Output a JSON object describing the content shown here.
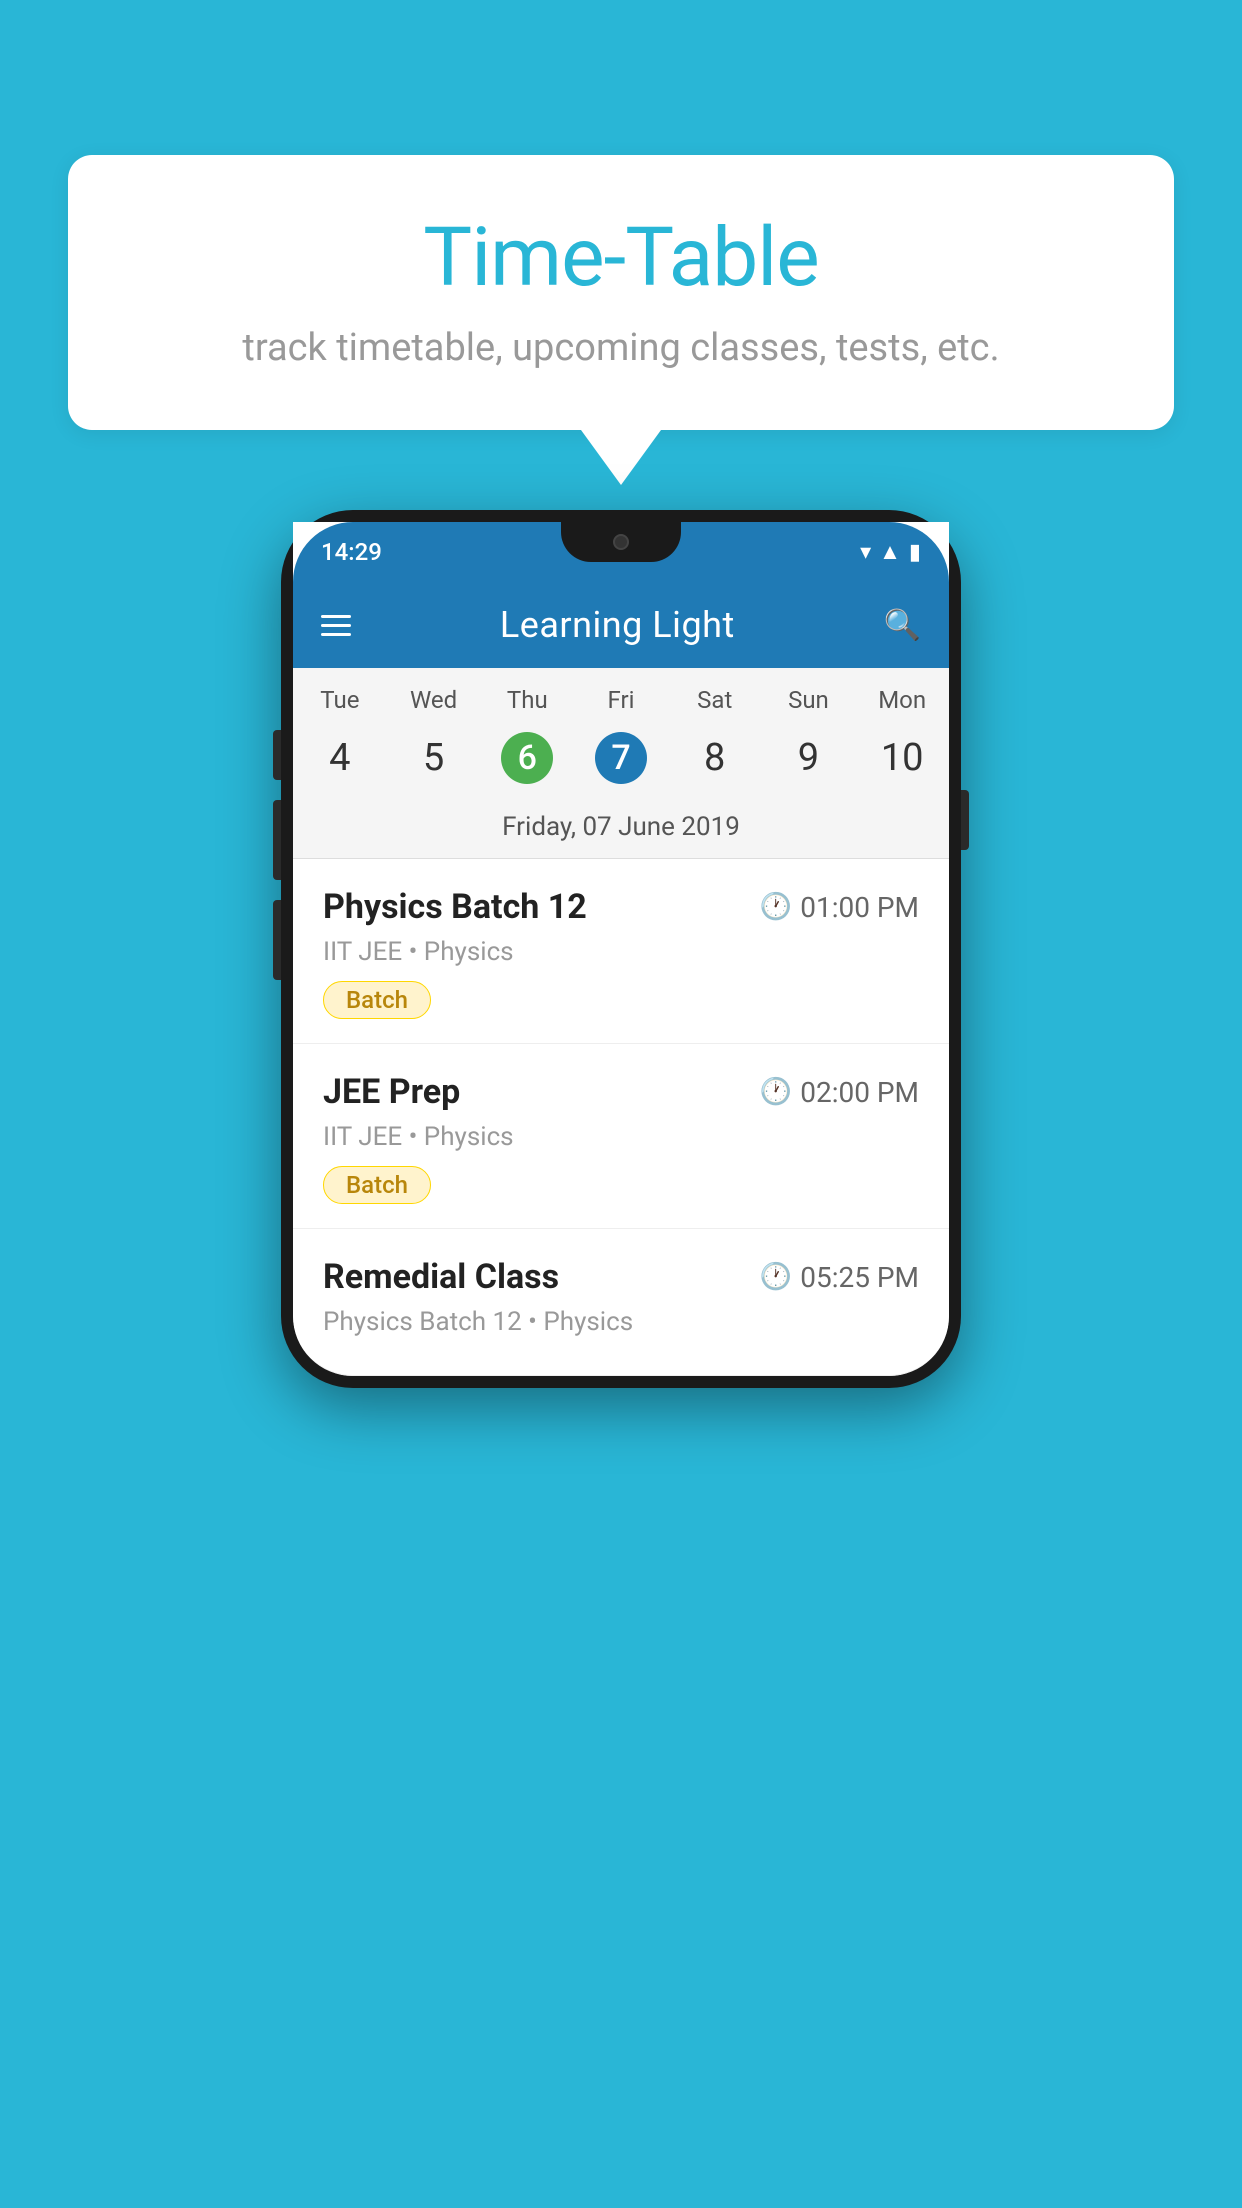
{
  "background_color": "#29B6D6",
  "bubble": {
    "title": "Time-Table",
    "subtitle": "track timetable, upcoming classes, tests, etc."
  },
  "phone": {
    "status_bar": {
      "time": "14:29"
    },
    "app_bar": {
      "title": "Learning Light"
    },
    "calendar": {
      "days": [
        "Tue",
        "Wed",
        "Thu",
        "Fri",
        "Sat",
        "Sun",
        "Mon"
      ],
      "dates": [
        "4",
        "5",
        "6",
        "7",
        "8",
        "9",
        "10"
      ],
      "today_index": 2,
      "selected_index": 3,
      "selected_label": "Friday, 07 June 2019"
    },
    "schedule": [
      {
        "title": "Physics Batch 12",
        "time": "01:00 PM",
        "meta": "IIT JEE • Physics",
        "tag": "Batch"
      },
      {
        "title": "JEE Prep",
        "time": "02:00 PM",
        "meta": "IIT JEE • Physics",
        "tag": "Batch"
      },
      {
        "title": "Remedial Class",
        "time": "05:25 PM",
        "meta": "Physics Batch 12 • Physics",
        "tag": ""
      }
    ]
  }
}
